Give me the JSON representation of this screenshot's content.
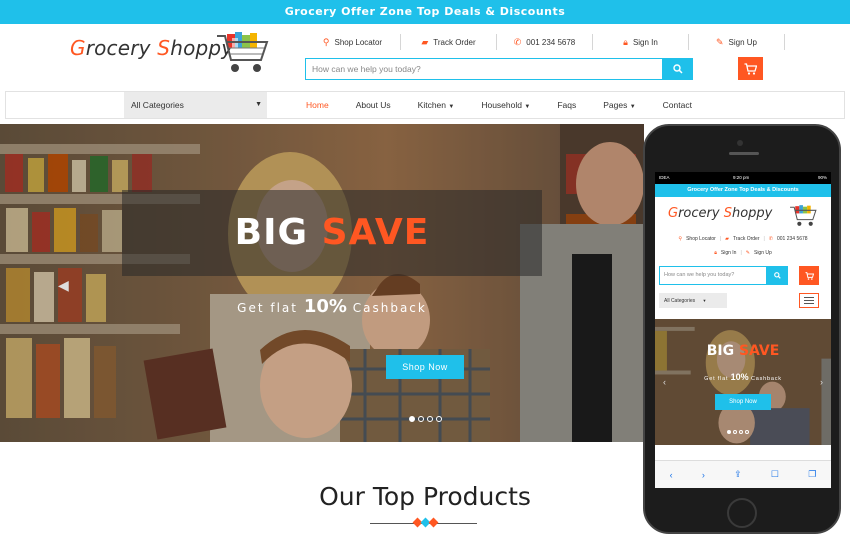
{
  "promo_bar": {
    "text": "Grocery Offer Zone Top Deals & Discounts"
  },
  "brand": {
    "name_first_letter": "G",
    "name_rest1": "rocery ",
    "name_second_letter": "S",
    "name_rest2": "hoppy"
  },
  "top_links": [
    {
      "icon": "map-marker-icon",
      "label": "Shop Locator"
    },
    {
      "icon": "truck-icon",
      "label": "Track Order"
    },
    {
      "icon": "phone-icon",
      "label": "001 234 5678"
    },
    {
      "icon": "lock-icon",
      "label": "Sign In"
    },
    {
      "icon": "edit-icon",
      "label": "Sign Up"
    }
  ],
  "search": {
    "placeholder": "How can we help you today?"
  },
  "nav": {
    "category_select": "All Categories",
    "items": [
      "Home",
      "About Us",
      "Kitchen",
      "Household",
      "Faqs",
      "Pages",
      "Contact"
    ],
    "dropdown_items": [
      "Kitchen",
      "Household",
      "Pages"
    ],
    "active": "Home"
  },
  "hero": {
    "title_part1": "BIG",
    "title_part2": "SAVE",
    "subtitle_pre": "Get flat",
    "subtitle_big": "10%",
    "subtitle_post": "Cashback",
    "button": "Shop Now",
    "slides": 4,
    "active_slide": 1
  },
  "section": {
    "title": "Our Top Products"
  },
  "phone": {
    "status_carrier": "IDEA",
    "status_time": "9:20 pm",
    "status_battery": "90%",
    "links_row1": [
      "Shop Locator",
      "Track Order",
      "001 234 5678"
    ],
    "links_row2": [
      "Sign In",
      "Sign Up"
    ]
  },
  "colors": {
    "accent": "#ff5722",
    "primary": "#1fc0ea"
  }
}
